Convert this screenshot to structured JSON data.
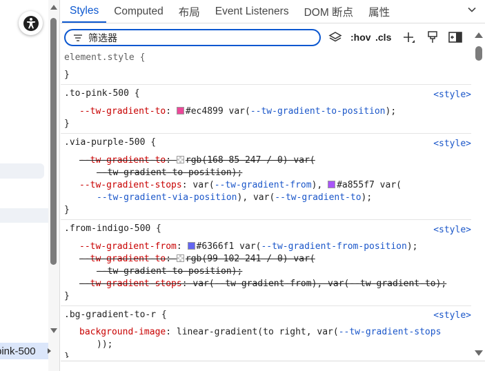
{
  "tabs": [
    {
      "label": "Styles",
      "active": true
    },
    {
      "label": "Computed"
    },
    {
      "label": "布局"
    },
    {
      "label": "Event Listeners"
    },
    {
      "label": "DOM 断点"
    },
    {
      "label": "属性"
    }
  ],
  "filter": {
    "placeholder": "筛选器"
  },
  "toolbar": {
    "hov_label": ":hov",
    "cls_label": ".cls"
  },
  "breadcrumb": {
    "label": "pink-500"
  },
  "colors": {
    "pink": "#ec4899",
    "purple": "#a855f7",
    "indigo": "#6366f1",
    "accent": "#0b57d0"
  },
  "rules": {
    "element_style": {
      "selector": "element.style {",
      "close": "}"
    },
    "to_pink": {
      "selector": ".to-pink-500 {",
      "source": "<style>",
      "prop": "--tw-gradient-to",
      "value_hex": "#ec4899",
      "value_var": "--tw-gradient-to-position",
      "close": "}"
    },
    "via_purple": {
      "selector": ".via-purple-500 {",
      "source": "<style>",
      "p1": "--tw-gradient-to",
      "p1_value": "rgb(168 85 247 / 0) var(",
      "p1_cont": "--tw-gradient-to-position",
      "p2": "--tw-gradient-stops",
      "p2_var1": "--tw-gradient-from",
      "p2_hex": "#a855f7",
      "p2_var2": "--tw-gradient-via-position",
      "p2_var3": "--tw-gradient-to",
      "close": "}"
    },
    "from_indigo": {
      "selector": ".from-indigo-500 {",
      "source": "<style>",
      "p1": "--tw-gradient-from",
      "p1_hex": "#6366f1",
      "p1_var": "--tw-gradient-from-position",
      "p2": "--tw-gradient-to",
      "p2_value": "rgb(99 102 241 / 0) var(",
      "p2_cont": "--tw-gradient-to-position",
      "p3": "--tw-gradient-stops",
      "p3_var1": "--tw-gradient-from",
      "p3_var2": "--tw-gradient-to",
      "close": "}"
    },
    "bg_gradient": {
      "selector": ".bg-gradient-to-r {",
      "source": "<style>",
      "prop": "background-image",
      "value": "linear-gradient(to right, var(",
      "value_var": "--tw-gradient-stops",
      "value_end": "));",
      "close": "}"
    }
  }
}
